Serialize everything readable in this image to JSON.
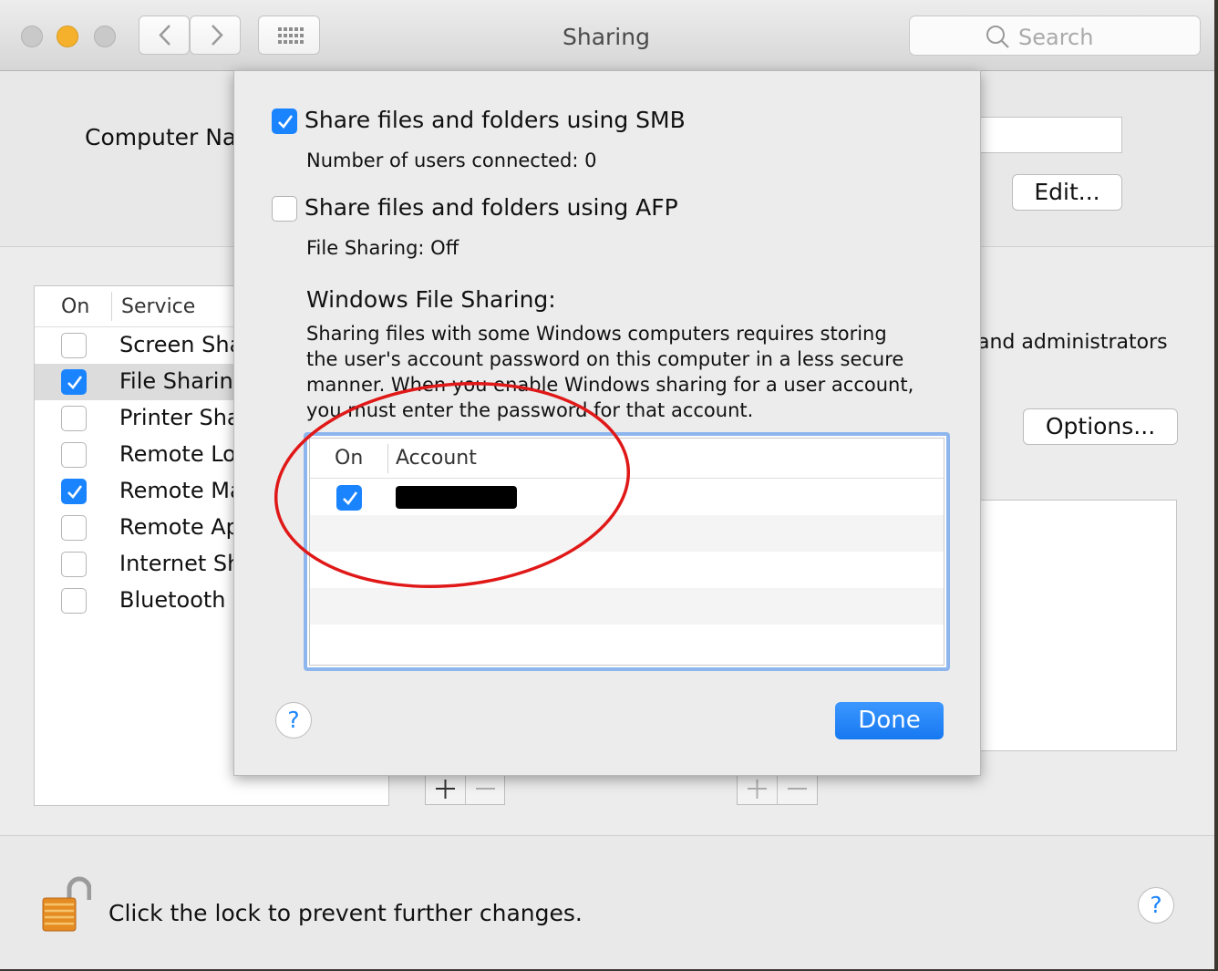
{
  "window": {
    "title": "Sharing",
    "search_placeholder": "Search"
  },
  "colors": {
    "accent": "#1a84ff",
    "annotation": "#e01818",
    "close": "#c9c9c9",
    "minimize": "#f5b12b",
    "zoom": "#c9c9c9"
  },
  "background": {
    "computer_name_label": "Computer Nar",
    "edit_button": "Edit...",
    "admin_text": "and administrators",
    "options_button": "Options...",
    "services_header_on": "On",
    "services_header_service": "Service",
    "services": [
      {
        "label": "Screen Sha",
        "checked": false
      },
      {
        "label": "File Sharing",
        "checked": true,
        "selected": true
      },
      {
        "label": "Printer Sha",
        "checked": false
      },
      {
        "label": "Remote Log",
        "checked": false
      },
      {
        "label": "Remote Ma",
        "checked": true
      },
      {
        "label": "Remote App",
        "checked": false
      },
      {
        "label": "Internet Sh",
        "checked": false
      },
      {
        "label": "Bluetooth S",
        "checked": false
      }
    ]
  },
  "footer": {
    "lock_text": "Click the lock to prevent further changes.",
    "help_glyph": "?"
  },
  "sheet": {
    "smb_label": "Share files and folders using SMB",
    "smb_checked": true,
    "smb_users": "Number of users connected: 0",
    "afp_label": "Share files and folders using AFP",
    "afp_checked": false,
    "afp_status": "File Sharing: Off",
    "windows_heading": "Windows File Sharing:",
    "windows_desc_1": "Sharing files with some Windows computers requires storing",
    "windows_desc_2": "the user's account password on this computer in a less secure",
    "windows_desc_3": "manner.  When you enable Windows sharing for a user account,",
    "windows_desc_4": "you must enter the password for that account.",
    "table_header_on": "On",
    "table_header_account": "Account",
    "accounts": [
      {
        "checked": true,
        "name_redacted": true
      }
    ],
    "help_glyph": "?",
    "done_button": "Done"
  }
}
